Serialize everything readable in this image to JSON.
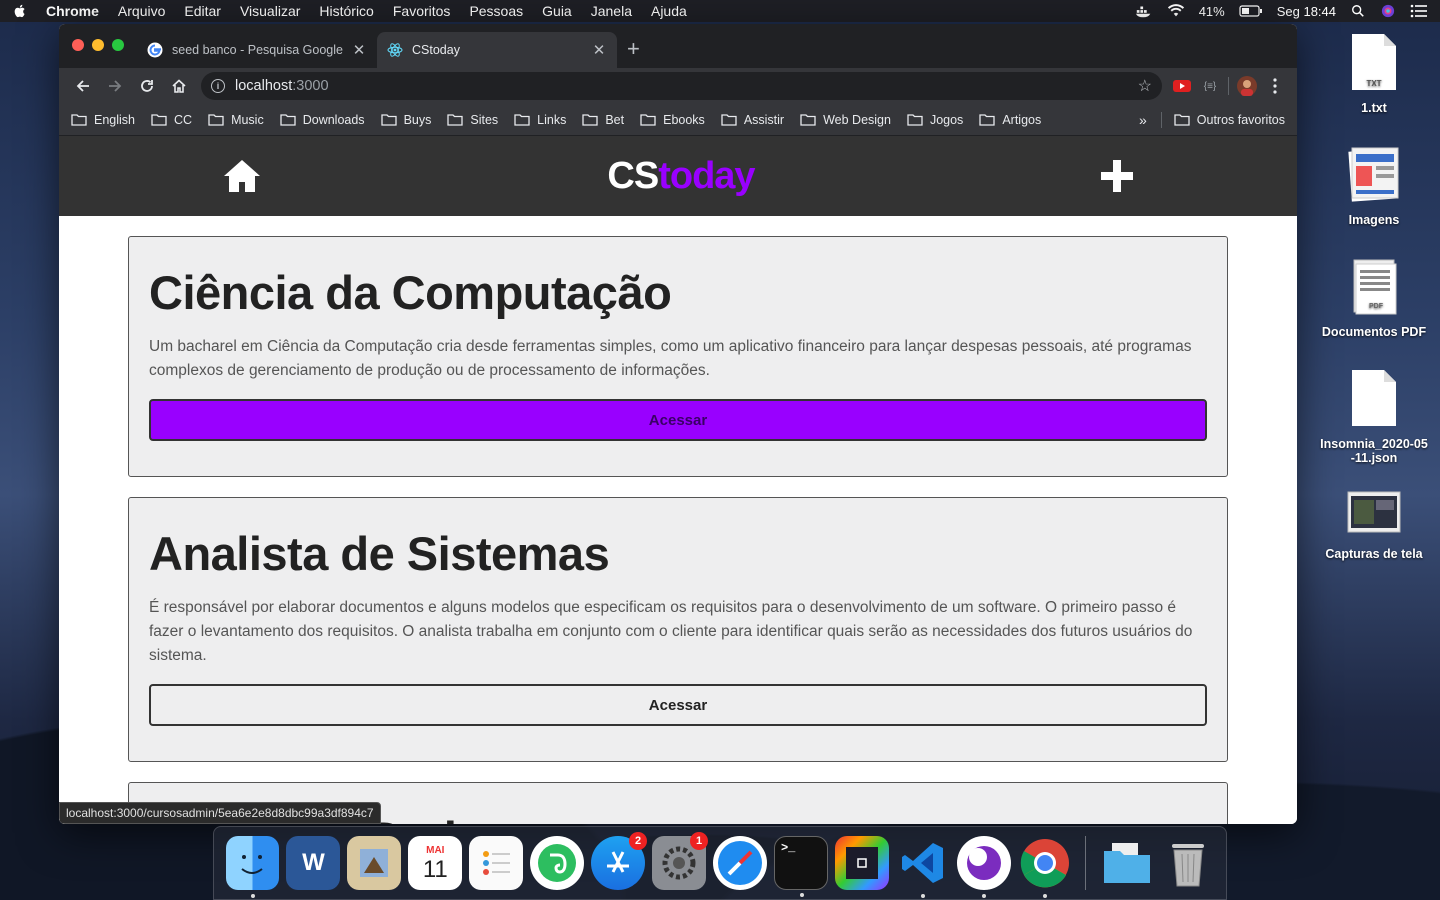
{
  "menubar": {
    "app_name": "Chrome",
    "items": [
      "Arquivo",
      "Editar",
      "Visualizar",
      "Histórico",
      "Favoritos",
      "Pessoas",
      "Guia",
      "Janela",
      "Ajuda"
    ],
    "battery": "41%",
    "clock": "Seg 18:44"
  },
  "browser": {
    "tabs": [
      {
        "title": "seed banco - Pesquisa Google",
        "favicon": "google-icon"
      },
      {
        "title": "CStoday",
        "favicon": "react-icon"
      }
    ],
    "address": {
      "host": "localhost",
      "port": ":3000"
    },
    "bookmarks": [
      "English",
      "CC",
      "Music",
      "Downloads",
      "Buys",
      "Sites",
      "Links",
      "Bet",
      "Ebooks",
      "Assistir",
      "Web Design",
      "Jogos",
      "Artigos"
    ],
    "bookmarks_more": "»",
    "other_bookmarks": "Outros favoritos",
    "status_url": "localhost:3000/cursosadmin/5ea6e2e8d8dbc99a3df894c7"
  },
  "app": {
    "logo_part1": "CS",
    "logo_part2": "today",
    "accent": "#9900ff",
    "cards": [
      {
        "title": "Ciência da Computação",
        "description": "Um bacharel em Ciência da Computação cria desde ferramentas simples, como um aplicativo financeiro para lançar despesas pessoais, até programas complexos de gerenciamento de produção ou de processamento de informações.",
        "button": "Acessar"
      },
      {
        "title": "Analista de Sistemas",
        "description": "É responsável por elaborar documentos e alguns modelos que especificam os requisitos para o desenvolvimento de um software. O primeiro passo é fazer o levantamento dos requisitos. O analista trabalha em conjunto com o cliente para identificar quais serão as necessidades dos futuros usuários do sistema.",
        "button": "Acessar"
      },
      {
        "title": "Banco de Dados",
        "description": "",
        "button": ""
      }
    ]
  },
  "desktop": {
    "icons": [
      {
        "label": "1.txt",
        "badge": "TXT"
      },
      {
        "label": "Imagens"
      },
      {
        "label": "Documentos PDF",
        "badge": "PDF"
      },
      {
        "label": "Insomnia_2020-05\n-11.json"
      },
      {
        "label": "Capturas de tela"
      }
    ]
  },
  "dock": {
    "calendar_month": "MAI",
    "calendar_day": "11",
    "appstore_badge": "2",
    "prefs_badge": "1"
  }
}
